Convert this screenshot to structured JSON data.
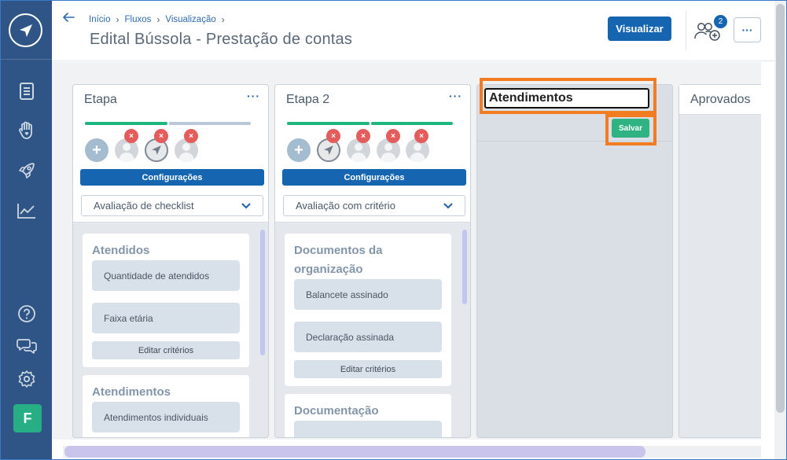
{
  "breadcrumb": [
    "Início",
    "Fluxos",
    "Visualização"
  ],
  "page_title": "Edital Bússola - Prestação de contas",
  "header": {
    "visualizar_label": "Visualizar",
    "participants_count": "2",
    "more_label": "···"
  },
  "colors": {
    "sidebar": "#2e5585",
    "primary": "#1565b0",
    "success": "#2fb383",
    "highlight": "#f47c20",
    "progress_done": "#1fb57f",
    "progress_todo": "#b9c7d6"
  },
  "columns": [
    {
      "title": "Etapa",
      "menu": "···",
      "config_label": "Configurações",
      "evaluation": "Avaliação de checklist",
      "cards": [
        {
          "title": "Atendidos",
          "criteria": [
            "Quantidade de atendidos",
            "Faixa etária"
          ],
          "edit_label": "Editar critérios"
        },
        {
          "title": "Atendimentos",
          "criteria": [
            "Atendimentos individuais"
          ]
        }
      ]
    },
    {
      "title": "Etapa 2",
      "menu": "···",
      "config_label": "Configurações",
      "evaluation": "Avaliação com critério",
      "cards": [
        {
          "title": "Documentos da organização",
          "criteria": [
            "Balancete assinado",
            "Declaração assinada"
          ],
          "edit_label": "Editar critérios"
        },
        {
          "title": "Documentação",
          "criteria": [
            ""
          ]
        }
      ]
    }
  ],
  "editing_column": {
    "name_value": "Atendimentos",
    "save_label": "Salvar"
  },
  "next_column": {
    "title": "Aprovados"
  },
  "sidebar": {
    "items": [
      "document-icon",
      "hand-heart-icon",
      "rocket-icon",
      "chart-icon",
      "help-icon",
      "chat-icon",
      "settings-icon"
    ],
    "user_initial": "F"
  }
}
